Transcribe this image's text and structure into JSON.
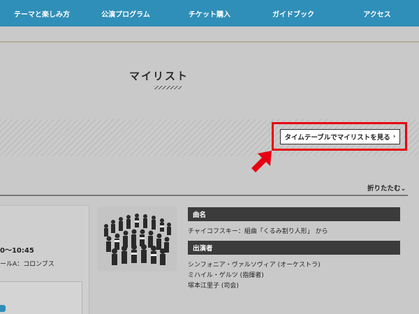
{
  "nav": {
    "items": [
      "テーマと楽しみ方",
      "公演プログラム",
      "チケット購入",
      "ガイドブック",
      "アクセス"
    ],
    "color": "#2f8fb8"
  },
  "page": {
    "title": "マイリスト"
  },
  "timetable_button": {
    "label": "タイムテーブルでマイリストを見る",
    "chevron": "›",
    "highlight_color": "#e60012"
  },
  "fold": {
    "label": "折りたたむ",
    "icon": "⌄"
  },
  "program": {
    "time": "0〜10:45",
    "venue": "ールA：コロンブス",
    "tag_icon": "tag-icon",
    "image_alt": "orchestra-photo",
    "sections": {
      "title_header": "曲名",
      "title_value": "チャイコフスキー：組曲「くるみ割り人形」 から",
      "performers_header": "出演者",
      "performers": [
        "シンフォニア・ヴァルソヴィア (オーケストラ)",
        "ミハイル・ゲルツ (指揮者)",
        "塚本江里子 (司会)"
      ]
    }
  }
}
